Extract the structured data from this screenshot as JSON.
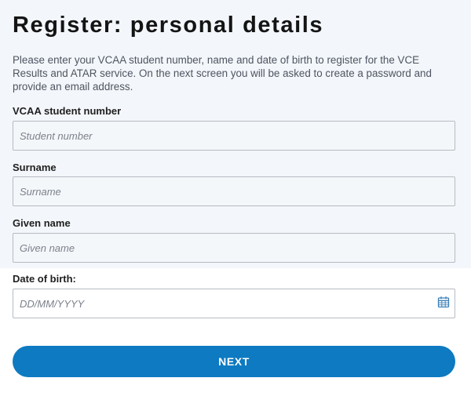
{
  "page": {
    "title": "Register: personal details",
    "intro": "Please enter your VCAA student number, name and date of birth to register for the VCE Results and ATAR service. On the next screen you will be asked to create a password and provide an email address."
  },
  "form": {
    "student_number": {
      "label": "VCAA student number",
      "placeholder": "Student number",
      "value": ""
    },
    "surname": {
      "label": "Surname",
      "placeholder": "Surname",
      "value": ""
    },
    "given_name": {
      "label": "Given name",
      "placeholder": "Given name",
      "value": ""
    },
    "dob": {
      "label": "Date of birth:",
      "placeholder": "DD/MM/YYYY",
      "value": "",
      "icon": "calendar-icon"
    },
    "next_label": "NEXT"
  },
  "colors": {
    "accent": "#0d7ac1",
    "upper_background": "#f3f6fa",
    "lower_background": "#ffffff"
  }
}
